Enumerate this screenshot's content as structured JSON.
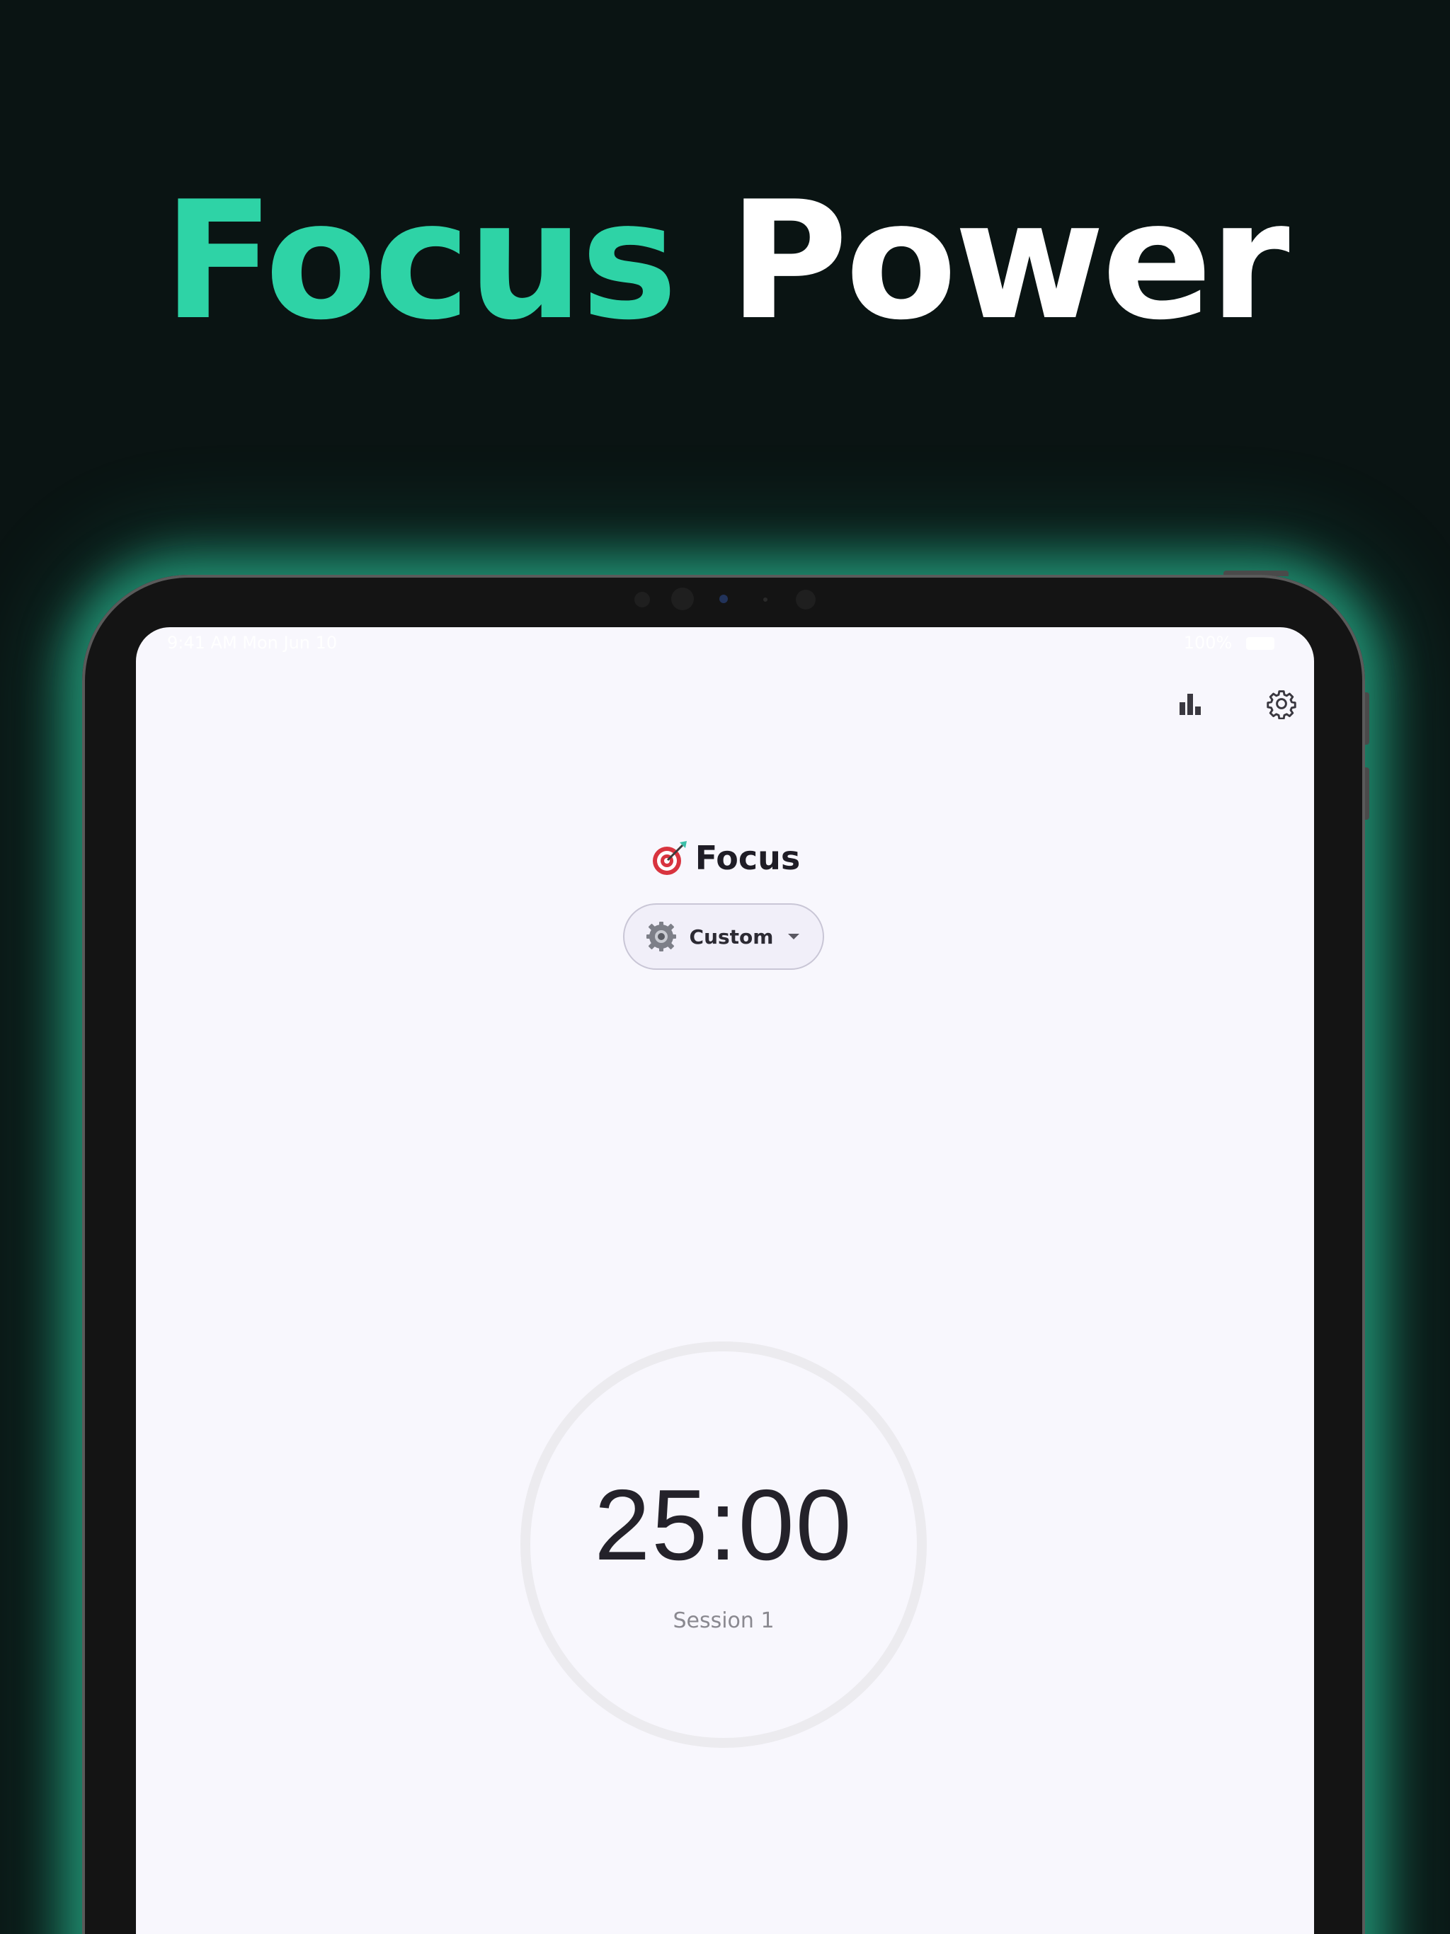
{
  "headline": {
    "accent_word": "Focus",
    "rest_word": "Power",
    "accent_color": "#2ed3a6",
    "rest_color": "#ffffff"
  },
  "status_bar": {
    "time": "9:41 AM  Mon Jun 10",
    "right": "100%"
  },
  "toolbar": {
    "stats_icon": "bar-chart-icon",
    "settings_icon": "gear-icon"
  },
  "screen": {
    "title_emoji": "direct-hit-target-icon",
    "title": "Focus",
    "mode_selector": {
      "icon": "gear-icon",
      "label": "Custom",
      "caret": "chevron-down-icon"
    },
    "timer": {
      "value": "25:00",
      "session": "Session 1"
    }
  },
  "colors": {
    "page_background": "#0a1413",
    "device_glow": "#2ed3a6",
    "screen_background": "#f8f7fd",
    "ring_color": "#ecebef",
    "chip_background": "#f1eff9"
  }
}
